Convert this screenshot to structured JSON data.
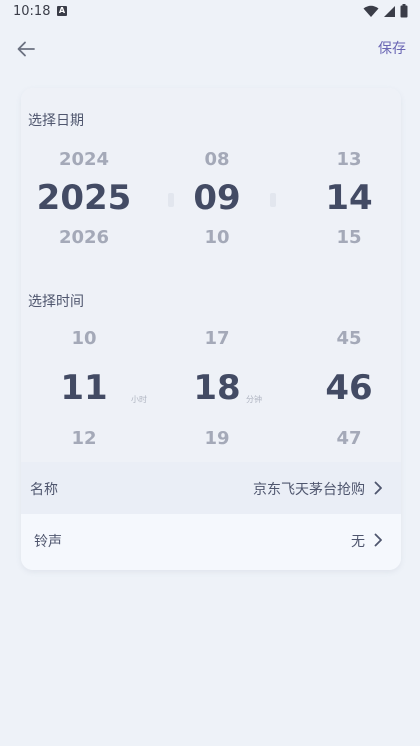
{
  "status_bar": {
    "time": "10:18",
    "notification_glyph": "A",
    "icons": [
      "wifi-icon",
      "cell-signal-icon",
      "battery-icon"
    ]
  },
  "header": {
    "back_icon": "back-arrow-icon",
    "save_label": "保存"
  },
  "date_picker": {
    "title": "选择日期",
    "year": {
      "prev": "2024",
      "current": "2025",
      "next": "2026"
    },
    "month": {
      "prev": "08",
      "current": "09",
      "next": "10"
    },
    "day": {
      "prev": "13",
      "current": "14",
      "next": "15"
    }
  },
  "time_picker": {
    "title": "选择时间",
    "hour": {
      "prev": "10",
      "current": "11",
      "next": "12",
      "unit": "小时"
    },
    "minute": {
      "prev": "17",
      "current": "18",
      "next": "19",
      "unit": "分钟"
    },
    "second": {
      "prev": "45",
      "current": "46",
      "next": "47"
    }
  },
  "name_row": {
    "label": "名称",
    "value": "京东飞天茅台抢购"
  },
  "ringtone_row": {
    "label": "铃声",
    "value": "无"
  },
  "colors": {
    "accent": "#6a66b4",
    "background": "#eef2f8",
    "card": "#f4f7fc",
    "wheel_center": "#434b64",
    "wheel_side": "#a4a9b8"
  }
}
